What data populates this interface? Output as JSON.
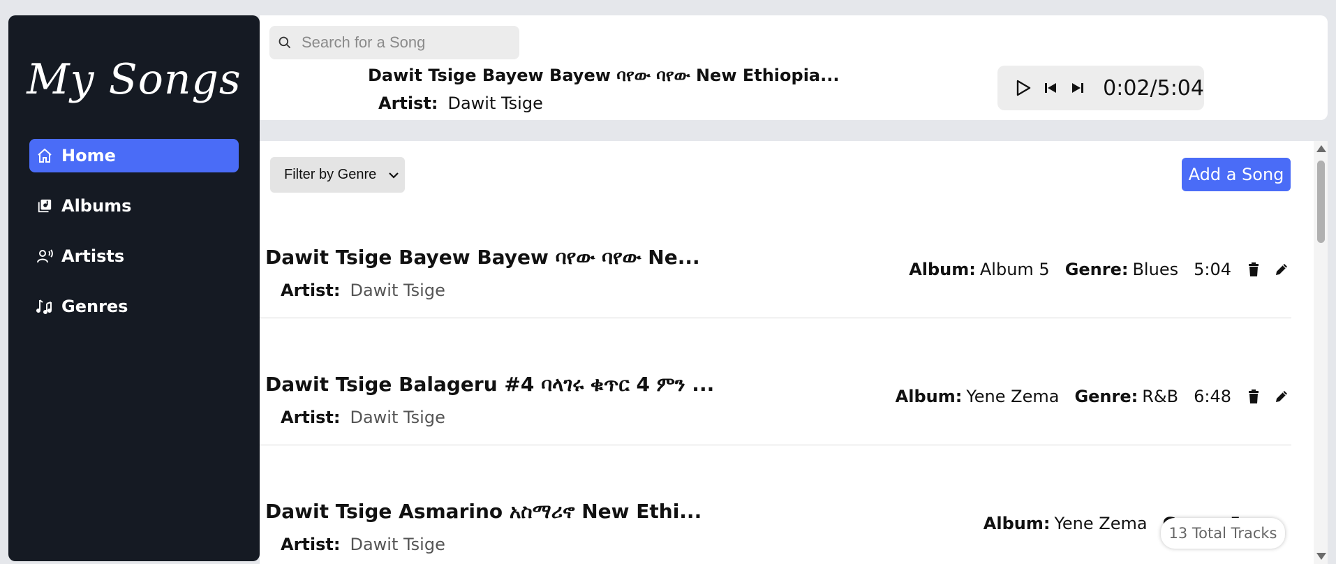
{
  "sidebar": {
    "logo": "My Songs",
    "items": [
      {
        "label": "Home",
        "icon": "home-icon",
        "active": true
      },
      {
        "label": "Albums",
        "icon": "albums-icon",
        "active": false
      },
      {
        "label": "Artists",
        "icon": "artists-icon",
        "active": false
      },
      {
        "label": "Genres",
        "icon": "music-notes-icon",
        "active": false
      }
    ]
  },
  "header": {
    "search": {
      "placeholder": "Search for a Song",
      "value": ""
    },
    "now_playing": {
      "title": "Dawit Tsige Bayew Bayew ባየው ባየው New Ethiopia...",
      "artist_label": "Artist:",
      "artist": "Dawit Tsige"
    },
    "player": {
      "time": "0:02/5:04"
    }
  },
  "main": {
    "filter_label": "Filter by Genre",
    "add_button": "Add a Song",
    "labels": {
      "artist": "Artist:",
      "album": "Album:",
      "genre": "Genre:"
    },
    "songs": [
      {
        "title": "Dawit Tsige Bayew Bayew ባየው ባየው Ne...",
        "artist": "Dawit Tsige",
        "album": "Album 5",
        "genre": "Blues",
        "duration": "5:04"
      },
      {
        "title": "Dawit Tsige Balageru #4 ባላገሩ ቁጥር 4 ምን ...",
        "artist": "Dawit Tsige",
        "album": "Yene Zema",
        "genre": "R&B",
        "duration": "6:48"
      },
      {
        "title": "Dawit Tsige Asmarino አስማሪኖ New Ethi...",
        "artist": "Dawit Tsige",
        "album": "Yene Zema",
        "genre": "Fo",
        "duration": ""
      }
    ],
    "total_tracks": "13 Total Tracks"
  },
  "colors": {
    "sidebar_bg": "#151a23",
    "accent": "#4a6cf7",
    "page_bg": "#e5e7eb"
  }
}
